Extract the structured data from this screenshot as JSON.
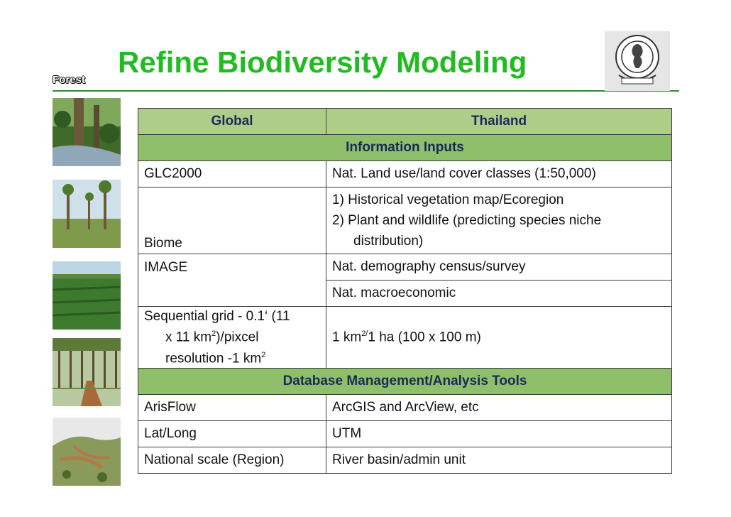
{
  "slide": {
    "side_label": "Forest",
    "title": "Refine Biodiversity Modeling"
  },
  "table": {
    "header": {
      "col1": "Global",
      "col2": "Thailand"
    },
    "section1": "Information Inputs",
    "row_glc": {
      "col1": "GLC2000",
      "col2": "Nat. Land use/land cover classes (1:50,000)"
    },
    "row_biome": {
      "col1": "Biome",
      "col2_line1": "1) Historical vegetation map/Ecoregion",
      "col2_line2": "2) Plant and wildlife (predicting species niche",
      "col2_line3": "distribution)"
    },
    "row_image": {
      "col1": "IMAGE",
      "col2a": "Nat. demography census/survey",
      "col2b": "Nat. macroeconomic"
    },
    "row_grid": {
      "col1_line1": "Sequential grid - 0.1‘ (11",
      "col1_line2a": "x 11 km",
      "col1_sup1": "2",
      "col1_line2b": ")/pixcel",
      "col1_line3a": "resolution -1 km",
      "col1_sup2": "2",
      "col2a": "1 km",
      "col2_sup": "2/",
      "col2b": "1 ha (100 x 100 m)"
    },
    "section2": "Database Management/Analysis Tools",
    "rows": [
      {
        "col1": "ArisFlow",
        "col2": "ArcGIS and ArcView, etc"
      },
      {
        "col1": "Lat/Long",
        "col2": "UTM"
      },
      {
        "col1": "National scale (Region)",
        "col2": "River basin/admin unit"
      }
    ]
  },
  "photos": [
    "forest-stream-photo",
    "sparse-trees-photo",
    "plantation-photo",
    "pine-road-photo",
    "cleared-hillside-photo"
  ]
}
